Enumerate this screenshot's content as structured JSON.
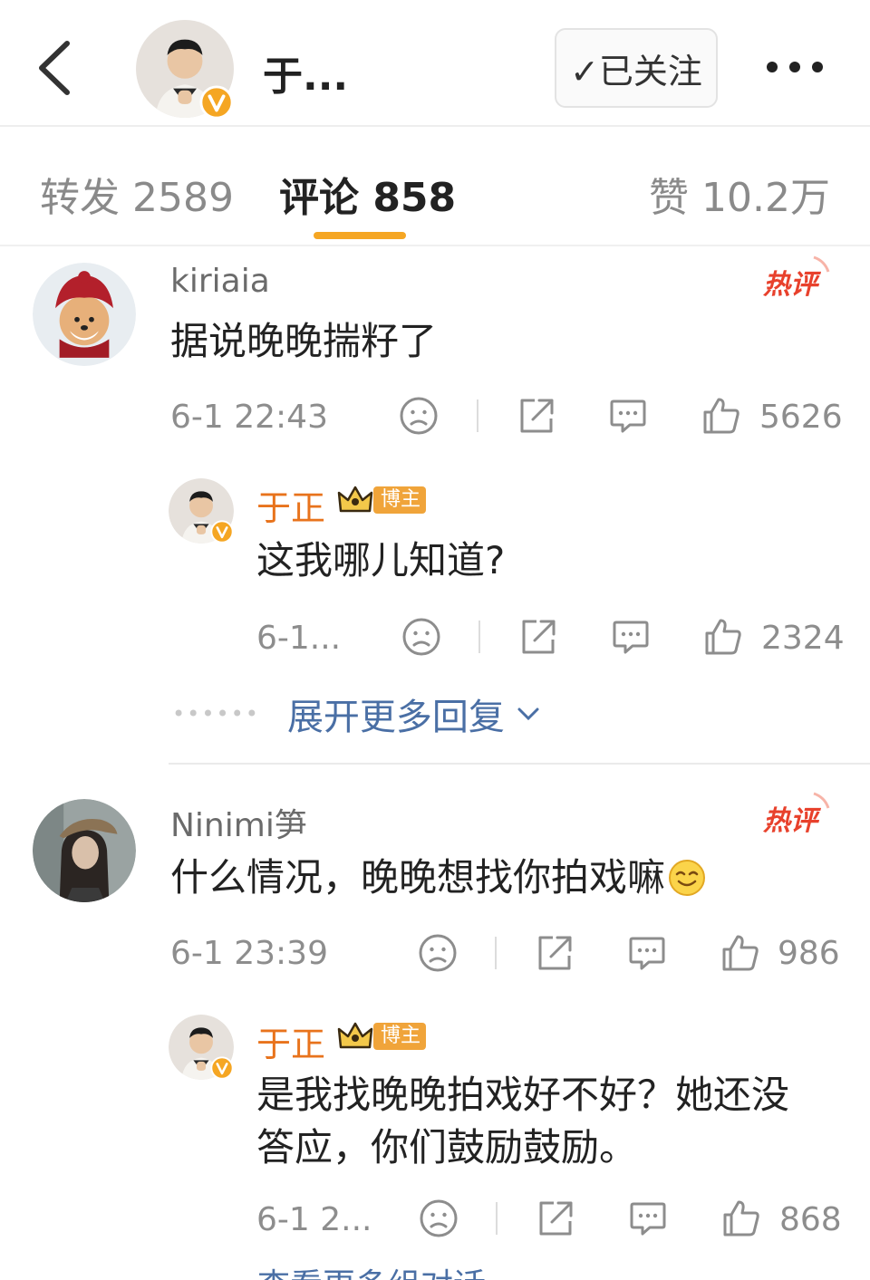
{
  "header": {
    "name": "于...",
    "follow_label": "✓已关注"
  },
  "tabs": {
    "repost": "转发 2589",
    "comment": "评论 858",
    "like": "赞 10.2万"
  },
  "colors": {
    "accent": "#f5a623",
    "owner_name": "#e8731c",
    "hot": "#e8412c",
    "link": "#4a6fa5"
  },
  "comments": [
    {
      "user": "kiriaia",
      "text": "据说晚晚揣籽了",
      "hot": "热评",
      "time": "6-1 22:43",
      "likes": "5626",
      "reply": {
        "user": "于正",
        "badge": "博主",
        "text": "这我哪儿知道?",
        "time": "6-1...",
        "likes": "2324"
      },
      "expand_label": "展开更多回复"
    },
    {
      "user": "Ninimi笋",
      "text": "什么情况，晚晚想找你拍戏嘛",
      "hot": "热评",
      "time": "6-1 23:39",
      "likes": "986",
      "reply": {
        "user": "于正",
        "badge": "博主",
        "text_line1": "是我找晚晚拍戏好不好？她还没",
        "text_line2": "答应，你们鼓励鼓励。",
        "time": "6-1 2...",
        "likes": "868"
      },
      "more_convo_label": "查看更多组对话"
    }
  ],
  "icons": [
    "back-arrow-icon",
    "verified-v-icon",
    "more-icon",
    "hot-comment-icon",
    "dislike-face-icon",
    "share-icon",
    "comment-icon",
    "thumb-up-icon",
    "crown-icon",
    "smile-emoji-icon"
  ]
}
